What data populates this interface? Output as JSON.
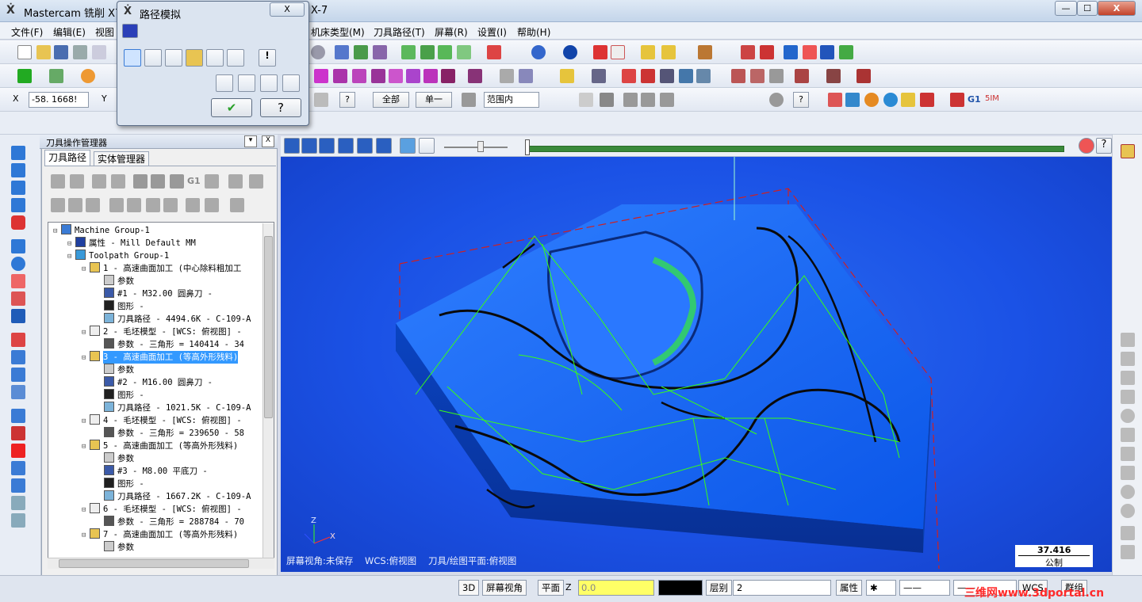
{
  "app": {
    "title": "Mastercam 铣削 X7",
    "title_suffix": "X-7"
  },
  "window_buttons": {
    "minimize": "—",
    "maximize": "☐",
    "close": "X"
  },
  "menu": [
    "文件(F)",
    "编辑(E)",
    "视图",
    "机床类型(M)",
    "刀具路径(T)",
    "屏幕(R)",
    "设置(I)",
    "帮助(H)"
  ],
  "coord": {
    "x_label": "X",
    "x_value": "-58. 1668!",
    "y_label": "Y"
  },
  "toolbar3": {
    "all_btn": "全部",
    "single_btn": "单一",
    "range_select": "范围内",
    "g1": "G1",
    "g_suffix": "5IM"
  },
  "dialog": {
    "title": "路径模拟",
    "close": "X",
    "ok": "✔",
    "help": "?"
  },
  "panel": {
    "title": "刀具操作管理器",
    "tab_toolpath": "刀具路径",
    "tab_solid": "实体管理器",
    "pin": "▾",
    "close": "X"
  },
  "tree": [
    {
      "indent": 0,
      "text": "Machine Group-1",
      "icon": "machine-group-icon",
      "color": "#3a7bd5"
    },
    {
      "indent": 1,
      "text": "属性 - Mill Default MM",
      "icon": "properties-icon",
      "color": "#2040a0"
    },
    {
      "indent": 1,
      "text": "Toolpath Group-1",
      "icon": "toolpath-group-icon",
      "color": "#3a9ad9"
    },
    {
      "indent": 2,
      "text": "1 - 高速曲面加工 (中心除料粗加工",
      "icon": "folder-icon",
      "color": "#e8c452"
    },
    {
      "indent": 3,
      "text": "参数",
      "icon": "params-icon",
      "color": "#cccccc"
    },
    {
      "indent": 3,
      "text": "#1 - M32.00 圆鼻刀 -",
      "icon": "tool-icon",
      "color": "#3b5aa8"
    },
    {
      "indent": 3,
      "text": "图形 -",
      "icon": "geometry-icon",
      "color": "#202020"
    },
    {
      "indent": 3,
      "text": "刀具路径 - 4494.6K - C-109-A",
      "icon": "toolpath-icon",
      "color": "#7cb3d9"
    },
    {
      "indent": 2,
      "text": "2 - 毛坯模型 - [WCS: 俯视图] -",
      "icon": "stock-model-icon",
      "color": "#eeeeee"
    },
    {
      "indent": 3,
      "text": "参数 - 三角形 = 140414 - 34",
      "icon": "mesh-params-icon",
      "color": "#555555"
    },
    {
      "indent": 2,
      "text": "3 - 高速曲面加工 (等高外形残料)",
      "icon": "folder-icon",
      "color": "#e8c452",
      "selected": true
    },
    {
      "indent": 3,
      "text": "参数",
      "icon": "params-icon",
      "color": "#cccccc"
    },
    {
      "indent": 3,
      "text": "#2 - M16.00 圆鼻刀 -",
      "icon": "tool-icon",
      "color": "#3b5aa8"
    },
    {
      "indent": 3,
      "text": "图形 -",
      "icon": "geometry-icon",
      "color": "#202020"
    },
    {
      "indent": 3,
      "text": "刀具路径 - 1021.5K - C-109-A",
      "icon": "toolpath-icon",
      "color": "#7cb3d9"
    },
    {
      "indent": 2,
      "text": "4 - 毛坯模型 - [WCS: 俯视图] -",
      "icon": "stock-model-icon",
      "color": "#eeeeee"
    },
    {
      "indent": 3,
      "text": "参数 - 三角形 = 239650 - 58",
      "icon": "mesh-params-icon",
      "color": "#555555"
    },
    {
      "indent": 2,
      "text": "5 - 高速曲面加工 (等高外形残料)",
      "icon": "folder-icon",
      "color": "#e8c452"
    },
    {
      "indent": 3,
      "text": "参数",
      "icon": "params-icon",
      "color": "#cccccc"
    },
    {
      "indent": 3,
      "text": "#3 - M8.00 平底刀 -",
      "icon": "tool-icon",
      "color": "#3b5aa8"
    },
    {
      "indent": 3,
      "text": "图形 -",
      "icon": "geometry-icon",
      "color": "#202020"
    },
    {
      "indent": 3,
      "text": "刀具路径 - 1667.2K - C-109-A",
      "icon": "toolpath-icon",
      "color": "#7cb3d9"
    },
    {
      "indent": 2,
      "text": "6 - 毛坯模型 - [WCS: 俯视图] -",
      "icon": "stock-model-icon",
      "color": "#eeeeee"
    },
    {
      "indent": 3,
      "text": "参数 - 三角形 = 288784 - 70",
      "icon": "mesh-params-icon",
      "color": "#555555"
    },
    {
      "indent": 2,
      "text": "7 - 高速曲面加工 (等高外形残料)",
      "icon": "folder-icon",
      "color": "#e8c452"
    },
    {
      "indent": 3,
      "text": "参数",
      "icon": "params-icon",
      "color": "#cccccc"
    }
  ],
  "viewport": {
    "screen_view": "屏幕视角:未保存",
    "wcs": "WCS:俯视图",
    "tool_plane": "刀具/绘图平面:俯视图",
    "scale_value": "37.416",
    "scale_unit": "公制",
    "axis_z": "Z",
    "axis_x": "X"
  },
  "status": {
    "btn_3d": "3D",
    "screen_view": "屏幕视角",
    "plane": "平面",
    "z_label": "Z",
    "z_value": "0.0",
    "level_label": "层别",
    "level_value": "2",
    "properties": "属性",
    "wcs": "WCS",
    "group": "群组"
  },
  "watermark": "三维网www.3dportal.cn",
  "colors": {
    "viewport_blue": "#1b52e6",
    "toolpath_green": "#39ff14",
    "selected_row": "#3399ff",
    "progress_green": "#3a8a3a"
  }
}
